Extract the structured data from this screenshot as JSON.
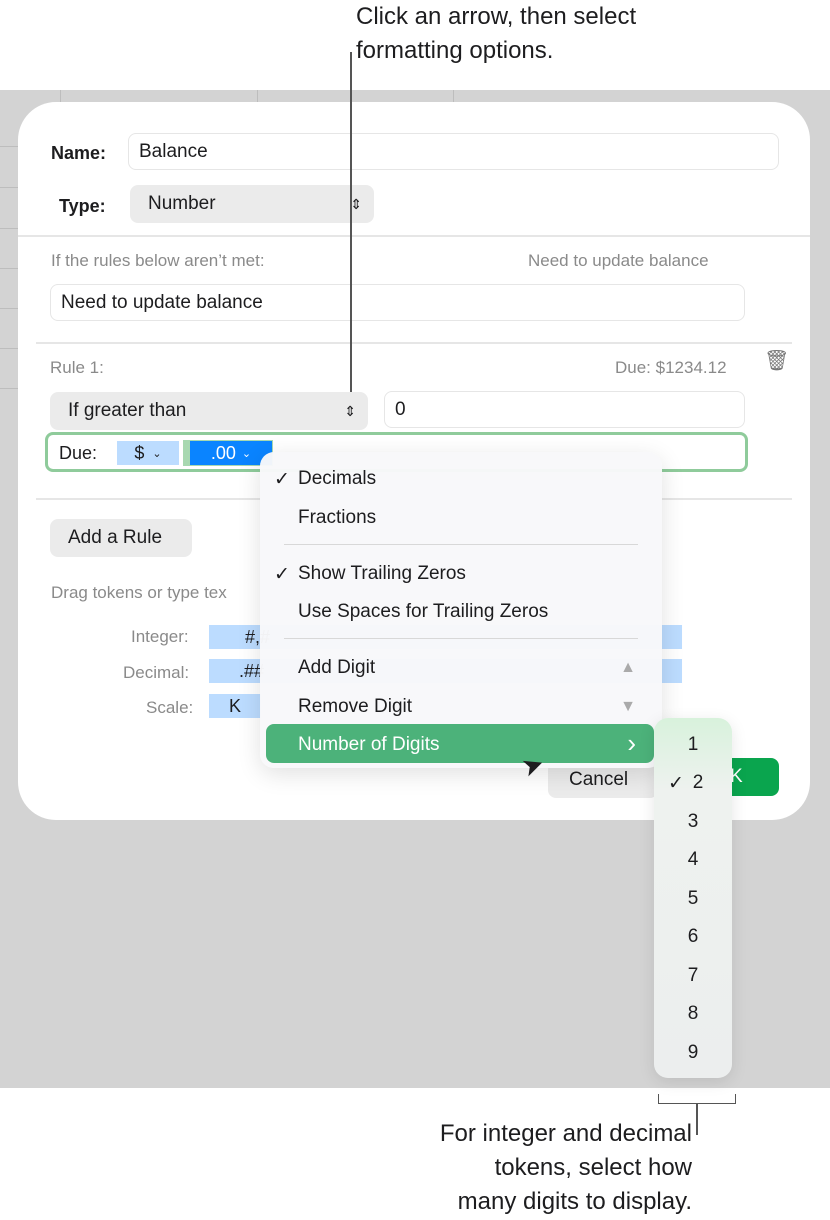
{
  "callouts": {
    "top": [
      "Click an arrow, then select",
      "formatting options."
    ],
    "bottom": [
      "For integer and decimal",
      "tokens, select how",
      "many digits to display."
    ]
  },
  "dialog": {
    "name_label": "Name:",
    "name_value": "Balance",
    "type_label": "Type:",
    "type_value": "Number",
    "unmet_label": "If the rules below aren’t met:",
    "unmet_preview": "Need to update balance",
    "unmet_value": "Need to update balance",
    "rule_label": "Rule 1:",
    "rule_preview": "Due: $1234.12",
    "condition": "If greater than",
    "condition_value": "0",
    "format_prefix": "Due:",
    "currency_token": "$",
    "decimal_token": ".00",
    "add_rule": "Add a Rule",
    "hint": "Drag tokens or type tex",
    "integer_label": "Integer:",
    "integer_token": "#,#",
    "decimal_label": "Decimal:",
    "decimal_token2": ".##",
    "scale_label": "Scale:",
    "scale_token": "K",
    "cancel": "Cancel",
    "ok": "K"
  },
  "menu": {
    "items": [
      "Decimals",
      "Fractions",
      "Show Trailing Zeros",
      "Use Spaces for Trailing Zeros",
      "Add Digit",
      "Remove Digit",
      "Number of Digits"
    ],
    "check": "✓",
    "up": "▲",
    "down": "▼",
    "arrow": "›"
  },
  "submenu": {
    "items": [
      "1",
      "2",
      "3",
      "4",
      "5",
      "6",
      "7",
      "8",
      "9"
    ],
    "selected": "2"
  },
  "colors": {
    "accent": "#4cb27a",
    "token": "#bcdcff",
    "token_selected": "#0a84ff"
  }
}
